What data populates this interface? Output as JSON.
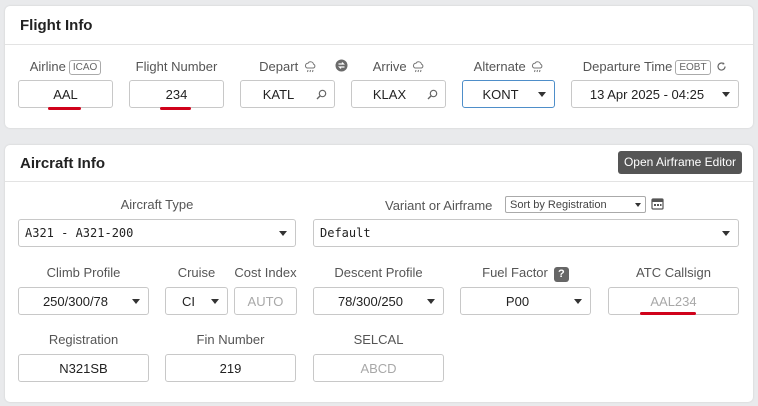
{
  "flight_info": {
    "title": "Flight Info",
    "airline": {
      "label": "Airline",
      "tag": "ICAO",
      "value": "AAL"
    },
    "flight_number": {
      "label": "Flight Number",
      "value": "234"
    },
    "depart": {
      "label": "Depart",
      "value": "KATL"
    },
    "arrive": {
      "label": "Arrive",
      "value": "KLAX"
    },
    "alternate": {
      "label": "Alternate",
      "value": "KONT"
    },
    "departure_time": {
      "label": "Departure Time",
      "tag": "EOBT",
      "value": "13 Apr 2025 - 04:25"
    }
  },
  "aircraft_info": {
    "title": "Aircraft Info",
    "editor_button": "Open Airframe Editor",
    "aircraft_type": {
      "label": "Aircraft Type",
      "value": "A321 - A321-200"
    },
    "variant": {
      "label": "Variant or Airframe",
      "sort_value": "Sort by Registration",
      "value": "Default"
    },
    "climb_profile": {
      "label": "Climb Profile",
      "value": "250/300/78"
    },
    "cruise": {
      "label": "Cruise",
      "value": "CI"
    },
    "cost_index": {
      "label": "Cost Index",
      "placeholder": "AUTO"
    },
    "descent_profile": {
      "label": "Descent Profile",
      "value": "78/300/250"
    },
    "fuel_factor": {
      "label": "Fuel Factor",
      "help": "?",
      "value": "P00"
    },
    "atc_callsign": {
      "label": "ATC Callsign",
      "placeholder": "AAL234"
    },
    "registration": {
      "label": "Registration",
      "value": "N321SB"
    },
    "fin_number": {
      "label": "Fin Number",
      "value": "219"
    },
    "selcal": {
      "label": "SELCAL",
      "placeholder": "ABCD"
    }
  },
  "colors": {
    "accent_underline": "#d0021b",
    "focus_border": "#4e8ec9",
    "button_bg": "#555555"
  },
  "icons": [
    "weather-icon",
    "swap-icon",
    "search-icon",
    "refresh-icon",
    "calendar-icon",
    "chevron-down-icon"
  ]
}
